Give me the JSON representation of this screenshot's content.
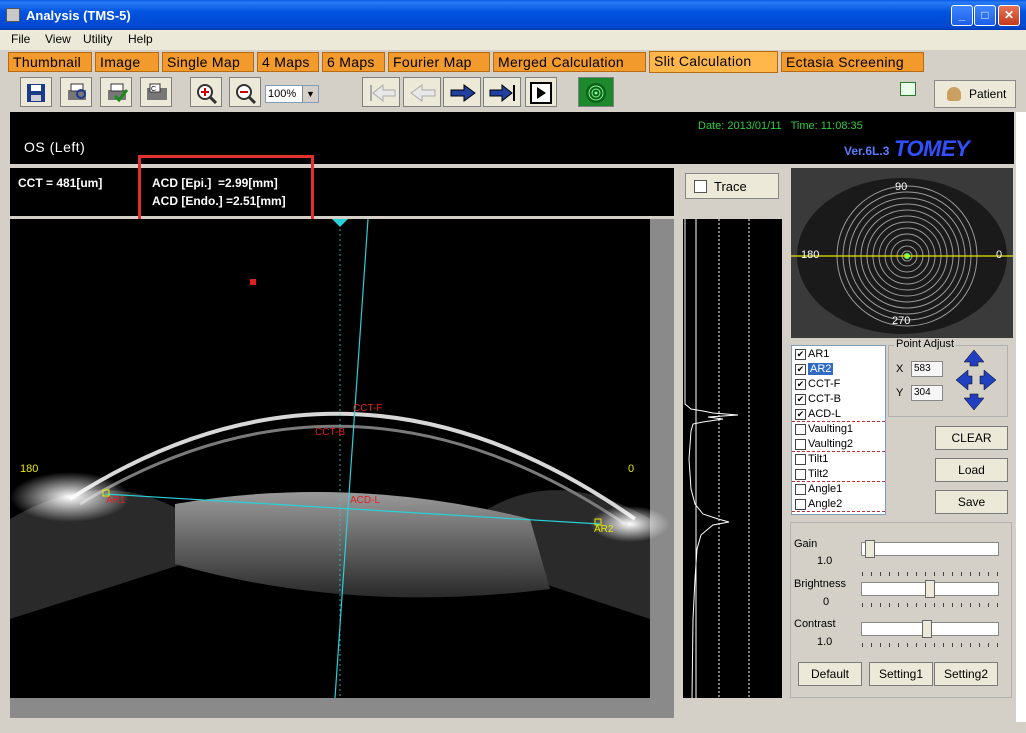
{
  "window": {
    "title": "Analysis (TMS-5)",
    "min": "_",
    "max": "□",
    "close": "✕"
  },
  "menu": [
    "File",
    "View",
    "Utility",
    "Help"
  ],
  "tabs": [
    "Thumbnail",
    "Image",
    "Single Map",
    "4 Maps",
    "6 Maps",
    "Fourier Map",
    "Merged Calculation",
    "Slit Calculation",
    "Ectasia Screening"
  ],
  "toolbar": {
    "zoom": "100%",
    "patient": "Patient"
  },
  "header": {
    "eye": "OS (Left)",
    "date": "Date: 2013/01/11",
    "time": "Time: 11:08:35",
    "version": "Ver.6L.3",
    "brand": "TOMEY"
  },
  "measurements": {
    "cct": "CCT = 481[um]",
    "acd_epi": "ACD [Epi.]  =2.99[mm]",
    "acd_endo": "ACD [Endo.] =2.51[mm]"
  },
  "image": {
    "left_angle": "180",
    "right_angle": "0",
    "labels": {
      "cct_f": "CCT-F",
      "cct_b": "CCT-B",
      "acd_l": "ACD-L",
      "ar1": "AR1",
      "ar2": "AR2"
    }
  },
  "trace": {
    "label": "Trace"
  },
  "thumbnail": {
    "top": "90",
    "left": "180",
    "right": "0",
    "bottom": "270"
  },
  "points": [
    {
      "label": "AR1",
      "checked": true
    },
    {
      "label": "AR2",
      "checked": true,
      "selected": true
    },
    {
      "label": "CCT-F",
      "checked": true
    },
    {
      "label": "CCT-B",
      "checked": true
    },
    {
      "label": "ACD-L",
      "checked": true
    },
    {
      "label": "Vaulting1",
      "checked": false
    },
    {
      "label": "Vaulting2",
      "checked": false
    },
    {
      "label": "Tilt1",
      "checked": false
    },
    {
      "label": "Tilt2",
      "checked": false
    },
    {
      "label": "Angle1",
      "checked": false
    },
    {
      "label": "Angle2",
      "checked": false
    }
  ],
  "point_adjust": {
    "title": "Point Adjust",
    "x_label": "X",
    "x": "583",
    "y_label": "Y",
    "y": "304"
  },
  "buttons": {
    "clear": "CLEAR",
    "load": "Load",
    "save": "Save",
    "default": "Default",
    "setting1": "Setting1",
    "setting2": "Setting2"
  },
  "sliders": {
    "gain": {
      "label": "Gain",
      "value": "1.0",
      "level": 0.02
    },
    "brightness": {
      "label": "Brightness",
      "value": "0",
      "level": 0.5
    },
    "contrast": {
      "label": "Contrast",
      "value": "1.0",
      "level": 0.48
    }
  },
  "colors": {
    "tab": "#f39a2c",
    "highlight": "#e03030",
    "cyan_line": "#2ad0d8",
    "label_red": "#e02020",
    "label_yellow": "#e8e800"
  }
}
